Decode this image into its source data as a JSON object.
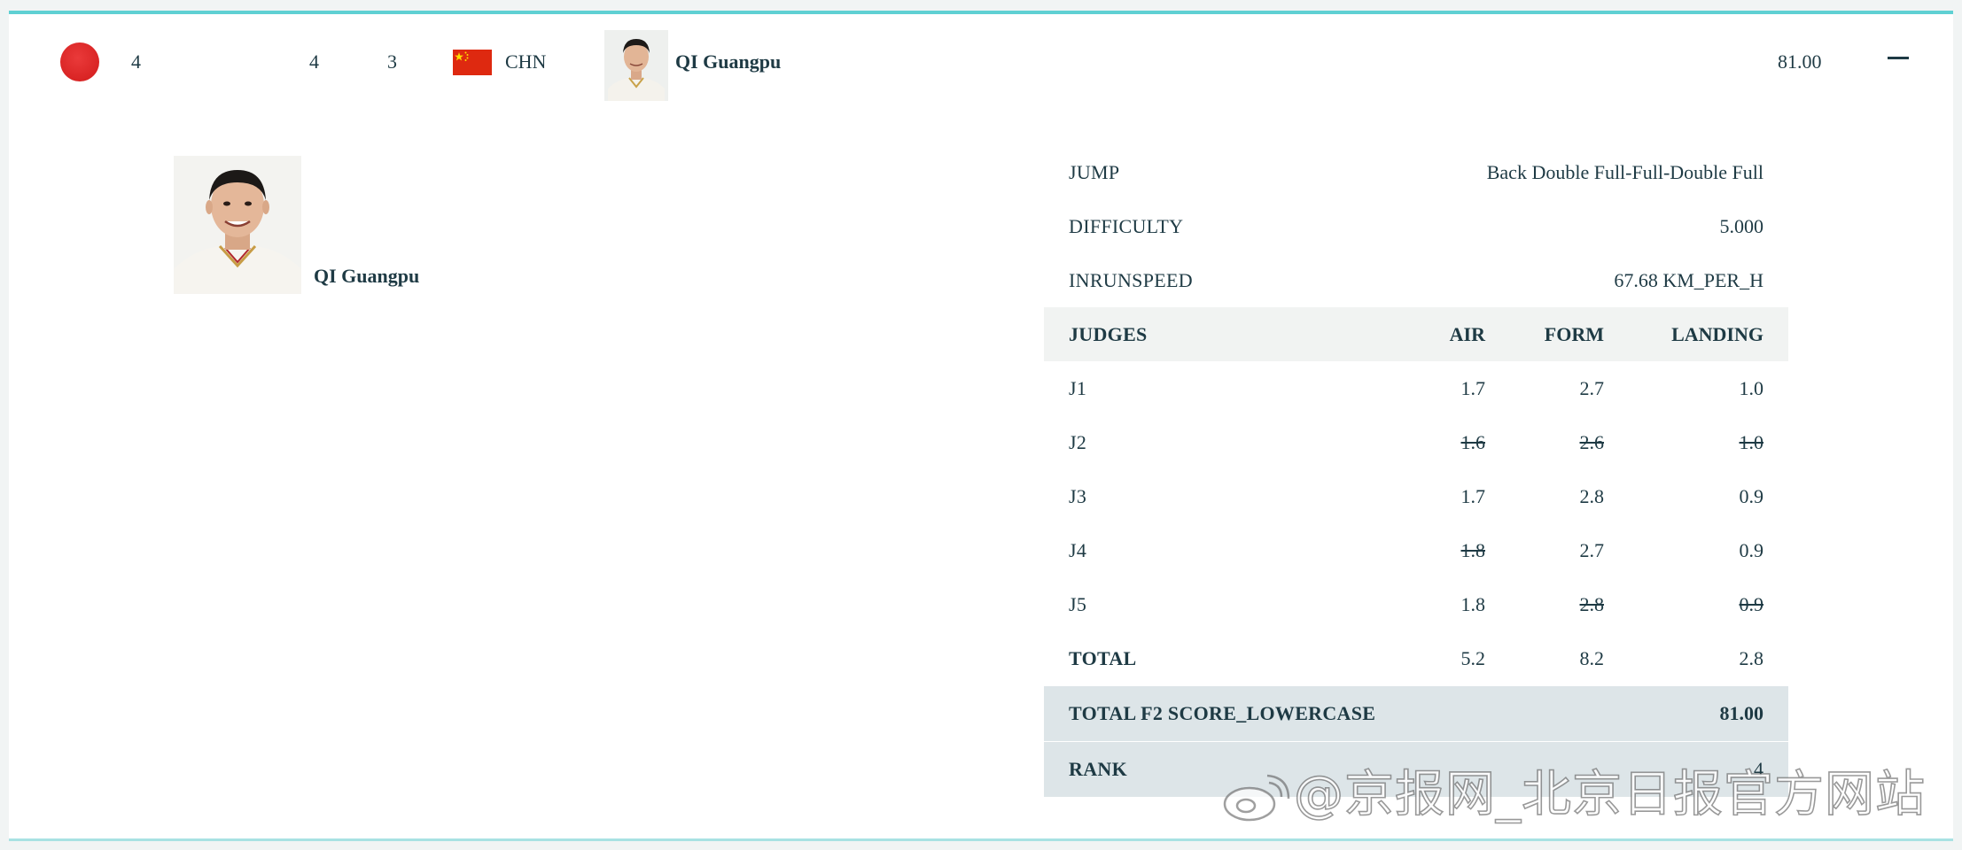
{
  "header": {
    "rank_color": "#d92424",
    "bib": "4",
    "col_a": "4",
    "col_b": "3",
    "country_code": "CHN",
    "athlete_name": "QI Guangpu",
    "score": "81.00",
    "collapse_icon": "minus-icon"
  },
  "athlete": {
    "name": "QI Guangpu"
  },
  "details": {
    "jump_label": "JUMP",
    "jump_value": "Back Double Full-Full-Double Full",
    "difficulty_label": "DIFFICULTY",
    "difficulty_value": "5.000",
    "inrunspeed_label": "INRUNSPEED",
    "inrunspeed_value": "67.68 KM_PER_H",
    "judges_header": {
      "judges": "JUDGES",
      "air": "AIR",
      "form": "FORM",
      "landing": "LANDING"
    },
    "judges": [
      {
        "judge": "J1",
        "air": "1.7",
        "form": "2.7",
        "landing": "1.0",
        "air_struck": false,
        "form_struck": false,
        "landing_struck": false
      },
      {
        "judge": "J2",
        "air": "1.6",
        "form": "2.6",
        "landing": "1.0",
        "air_struck": true,
        "form_struck": true,
        "landing_struck": true
      },
      {
        "judge": "J3",
        "air": "1.7",
        "form": "2.8",
        "landing": "0.9",
        "air_struck": false,
        "form_struck": false,
        "landing_struck": false
      },
      {
        "judge": "J4",
        "air": "1.8",
        "form": "2.7",
        "landing": "0.9",
        "air_struck": true,
        "form_struck": false,
        "landing_struck": false
      },
      {
        "judge": "J5",
        "air": "1.8",
        "form": "2.8",
        "landing": "0.9",
        "air_struck": false,
        "form_struck": true,
        "landing_struck": true
      }
    ],
    "total": {
      "label": "TOTAL",
      "air": "5.2",
      "form": "8.2",
      "landing": "2.8"
    },
    "total_score_label": "TOTAL F2 SCORE_LOWERCASE",
    "total_score_value": "81.00",
    "rank_label": "RANK",
    "rank_value": "4"
  },
  "watermark": {
    "text": "@京报网_北京日报官方网站",
    "logo_icon": "weibo-icon"
  }
}
